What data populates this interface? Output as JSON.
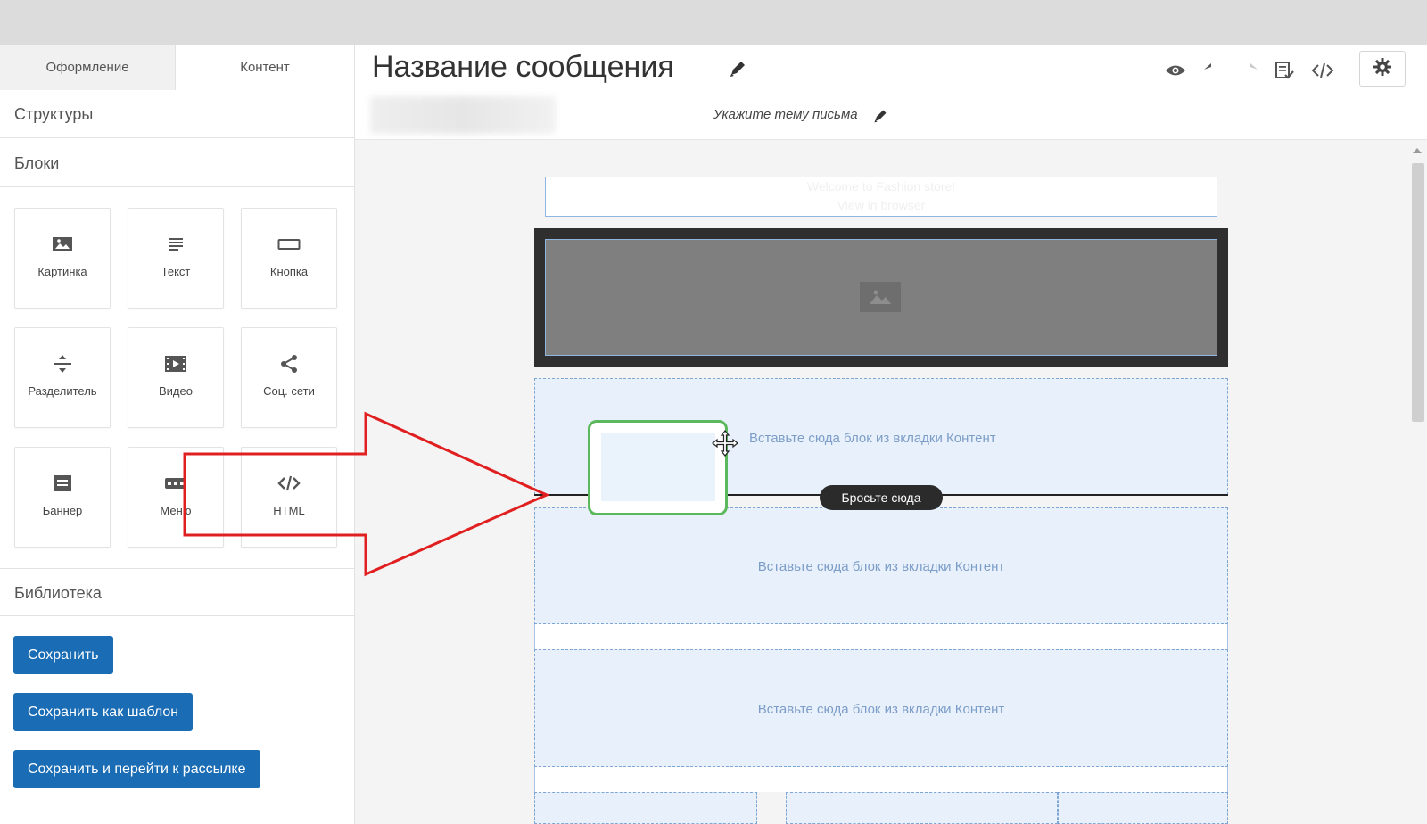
{
  "left_panel": {
    "tabs": [
      "Оформление",
      "Контент"
    ],
    "sections": {
      "structures": "Структуры",
      "blocks": "Блоки",
      "library": "Библиотека"
    },
    "blocks": [
      {
        "label": "Картинка",
        "icon": "image-icon"
      },
      {
        "label": "Текст",
        "icon": "text-icon"
      },
      {
        "label": "Кнопка",
        "icon": "button-icon"
      },
      {
        "label": "Разделитель",
        "icon": "divider-icon"
      },
      {
        "label": "Видео",
        "icon": "video-icon"
      },
      {
        "label": "Соц. сети",
        "icon": "share-icon"
      },
      {
        "label": "Баннер",
        "icon": "banner-icon"
      },
      {
        "label": "Меню",
        "icon": "menu-icon"
      },
      {
        "label": "HTML",
        "icon": "code-icon"
      }
    ],
    "buttons": {
      "save": "Сохранить",
      "save_template": "Сохранить как шаблон",
      "save_and_go": "Сохранить и перейти к рассылке"
    }
  },
  "header": {
    "title": "Название сообщения",
    "subject_placeholder": "Укажите тему письма",
    "tools": [
      "eye-icon",
      "undo-icon",
      "redo-icon",
      "checklist-icon",
      "code-icon",
      "gear-icon"
    ]
  },
  "canvas": {
    "preheader_line1": "Welcome to Fashion store!",
    "preheader_line2": "View in browser",
    "drop_hint": "Вставьте сюда блок из вкладки Контент",
    "drop_badge": "Бросьте сюда"
  },
  "colors": {
    "primary_button": "#1a6cb4",
    "drop_zone_bg": "#e8f1fb",
    "drop_zone_border": "#7fa6d3",
    "drag_ghost_border": "#5cb85c",
    "annotation_arrow": "#e02020"
  }
}
